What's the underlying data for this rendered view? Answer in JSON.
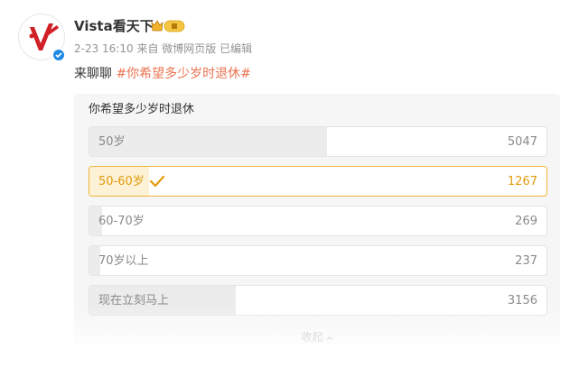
{
  "post": {
    "username": "Vista看天下",
    "meta": "2-23 16:10 来自 微博网页版 已编辑",
    "text_prefix": "来聊聊 ",
    "hashtag": "#你希望多少岁时退休#"
  },
  "poll": {
    "question": "你希望多少岁时退休",
    "options": [
      {
        "label": "50岁",
        "count": "5047",
        "share": 0.52,
        "selected": false
      },
      {
        "label": "50-60岁",
        "count": "1267",
        "share": 0.13,
        "selected": true
      },
      {
        "label": "60-70岁",
        "count": "269",
        "share": 0.028,
        "selected": false
      },
      {
        "label": "70岁以上",
        "count": "237",
        "share": 0.024,
        "selected": false
      },
      {
        "label": "现在立刻马上",
        "count": "3156",
        "share": 0.32,
        "selected": false
      }
    ],
    "collapse_label": "收起"
  },
  "colors": {
    "hashtag": "#eb7350",
    "selected_border": "#f0b436",
    "selected_text": "#e19b0b",
    "verified": "#1f8ae6"
  },
  "icons": {
    "avatar": "vista-logo",
    "badge": "crown-icon",
    "verified": "verified-icon",
    "selected": "check-icon",
    "collapse": "chevron-up-icon"
  }
}
